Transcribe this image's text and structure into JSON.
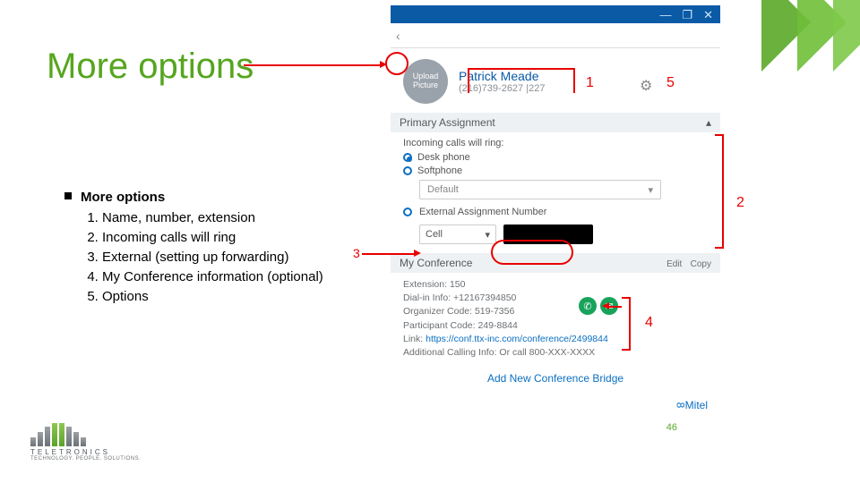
{
  "title": "More options",
  "bullets": {
    "heading": "More options",
    "items": [
      "Name, number, extension",
      "Incoming calls will ring",
      "External (setting up forwarding)",
      "My Conference information (optional)",
      "Options"
    ]
  },
  "labels": {
    "n1": "1",
    "n2": "2",
    "n3": "3",
    "n4": "4",
    "n5": "5"
  },
  "app": {
    "win": {
      "min": "—",
      "max": "❐",
      "close": "✕"
    },
    "back": "‹",
    "upload": "Upload Picture",
    "name": "Patrick Meade",
    "ext": "(216)739-2627 |227",
    "section1": "Primary Assignment",
    "incoming": "Incoming calls will ring:",
    "opt_desk": "Desk phone",
    "opt_soft": "Softphone",
    "dd_default": "Default",
    "ext_label": "External Assignment Number",
    "ext_dd": "Cell",
    "conf_hdr": "My Conference",
    "conf_edit": "Edit",
    "conf_copy": "Copy",
    "conf": {
      "extension": "Extension: 150",
      "dialin": "Dial-in Info: +12167394850",
      "organizer": "Organizer Code: 519-7356",
      "participant": "Participant Code: 249-8844",
      "link_lbl": "Link: ",
      "link": "https://conf.ttx-inc.com/conference/2499844",
      "addl": "Additional Calling Info: Or call 800-XXX-XXXX"
    },
    "add_bridge": "Add New Conference Bridge",
    "brand": "Mitel"
  },
  "gear_glyph": "⚙",
  "pill": {
    "call": "✆",
    "msg": "✉"
  },
  "page_number": "46",
  "logo_text": "TELETRONICS",
  "logo_tag": "TECHNOLOGY. PEOPLE. SOLUTIONS."
}
